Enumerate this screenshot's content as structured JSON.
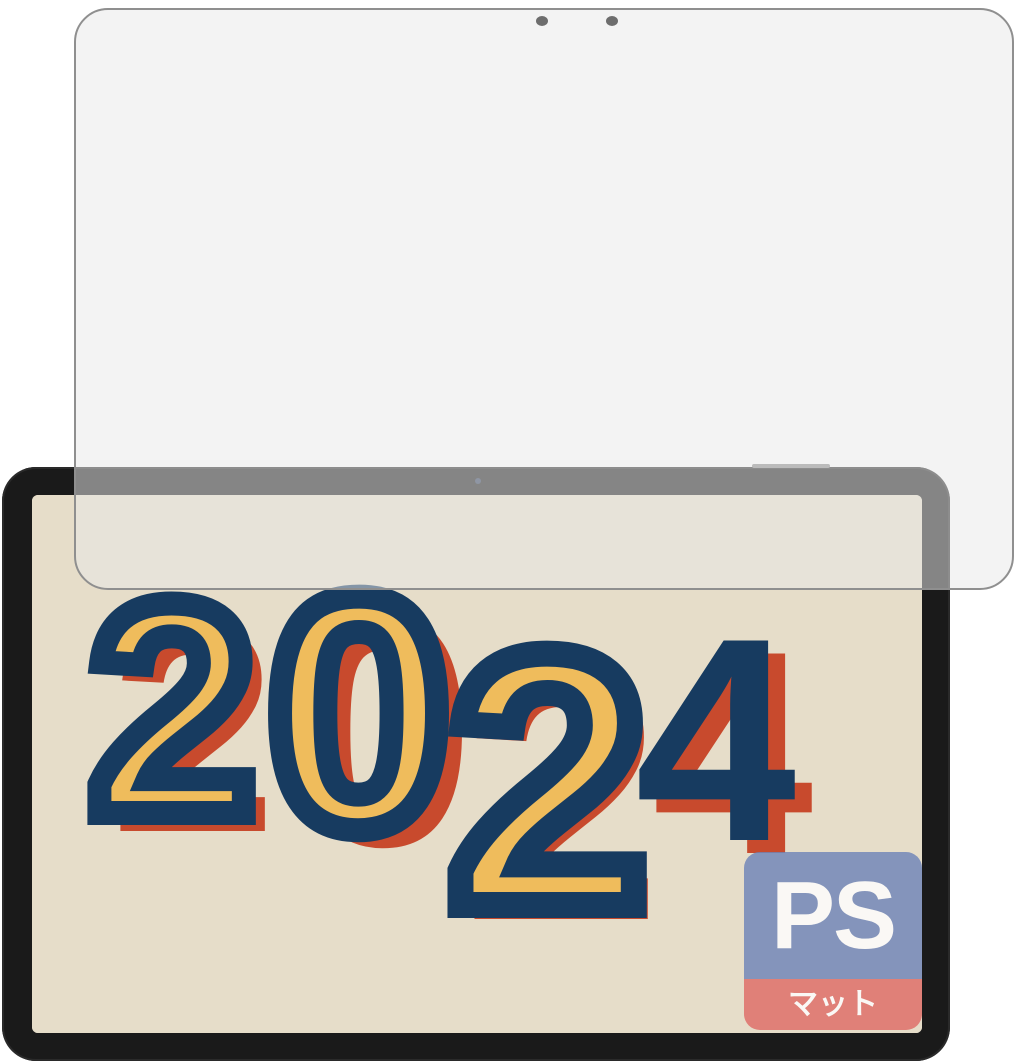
{
  "wallpaper": {
    "digits": [
      "2",
      "0",
      "2",
      "4"
    ],
    "colors": {
      "background": "#e6ddc9",
      "yellow": "#efbc5c",
      "orange": "#c84a2d",
      "navy": "#173b60"
    }
  },
  "badge": {
    "main": "PS",
    "sub": "マット",
    "colors": {
      "top": "#6f85b8",
      "bottom": "#df6c67",
      "text": "#ffffff"
    }
  },
  "icons": {
    "camera": "camera-icon",
    "film_holes": "film-hole-icon"
  }
}
